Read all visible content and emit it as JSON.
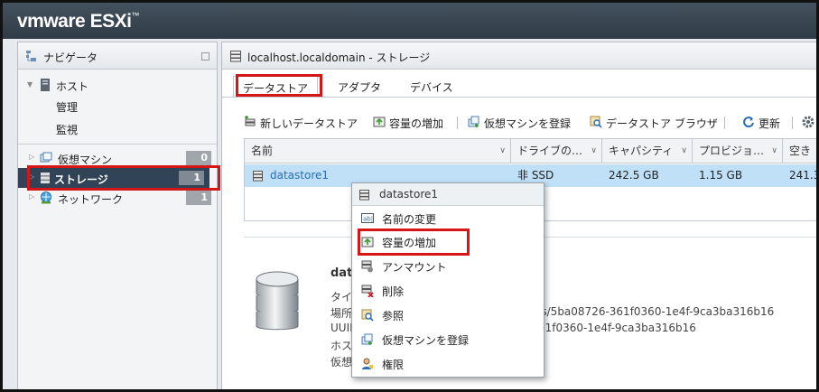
{
  "app": {
    "brand": "vmware",
    "product": "ESXi",
    "tm": "™"
  },
  "navigator": {
    "title": "ナビゲータ",
    "host": {
      "label": "ホスト",
      "children": [
        "管理",
        "監視"
      ]
    },
    "items": [
      {
        "label": "仮想マシン",
        "count": "0"
      },
      {
        "label": "ストレージ",
        "count": "1"
      },
      {
        "label": "ネットワーク",
        "count": "1"
      }
    ]
  },
  "main": {
    "title": "localhost.localdomain - ストレージ",
    "tabs": [
      "データストア",
      "アダプタ",
      "デバイス"
    ],
    "toolbar": [
      "新しいデータストア",
      "容量の増加",
      "仮想マシンを登録",
      "データストア ブラウザ",
      "更新"
    ],
    "columns": [
      "名前",
      "ドライブの…",
      "キャパシティ",
      "プロビジョ…",
      "空き"
    ],
    "rows": [
      {
        "name": "datastore1",
        "drive": "非 SSD",
        "capacity": "242.5 GB",
        "provisioned": "1.15 GB",
        "free": "241.3"
      }
    ],
    "detail": {
      "title": "data",
      "labels": [
        "タイ",
        "場所",
        "UUID",
        "ホス",
        "仮想"
      ],
      "location_tail": "es/5ba08726-361f0360-1e4f-9ca3ba316b16",
      "uuid_tail": "61f0360-1e4f-9ca3ba316b16"
    }
  },
  "context_menu": {
    "title": "datastore1",
    "items": [
      "名前の変更",
      "容量の増加",
      "アンマウント",
      "削除",
      "参照",
      "仮想マシンを登録",
      "権限"
    ]
  },
  "colors": {
    "highlight": "#d51616",
    "selected_row": "#bfe0f7",
    "nav_selected": "#314357"
  }
}
